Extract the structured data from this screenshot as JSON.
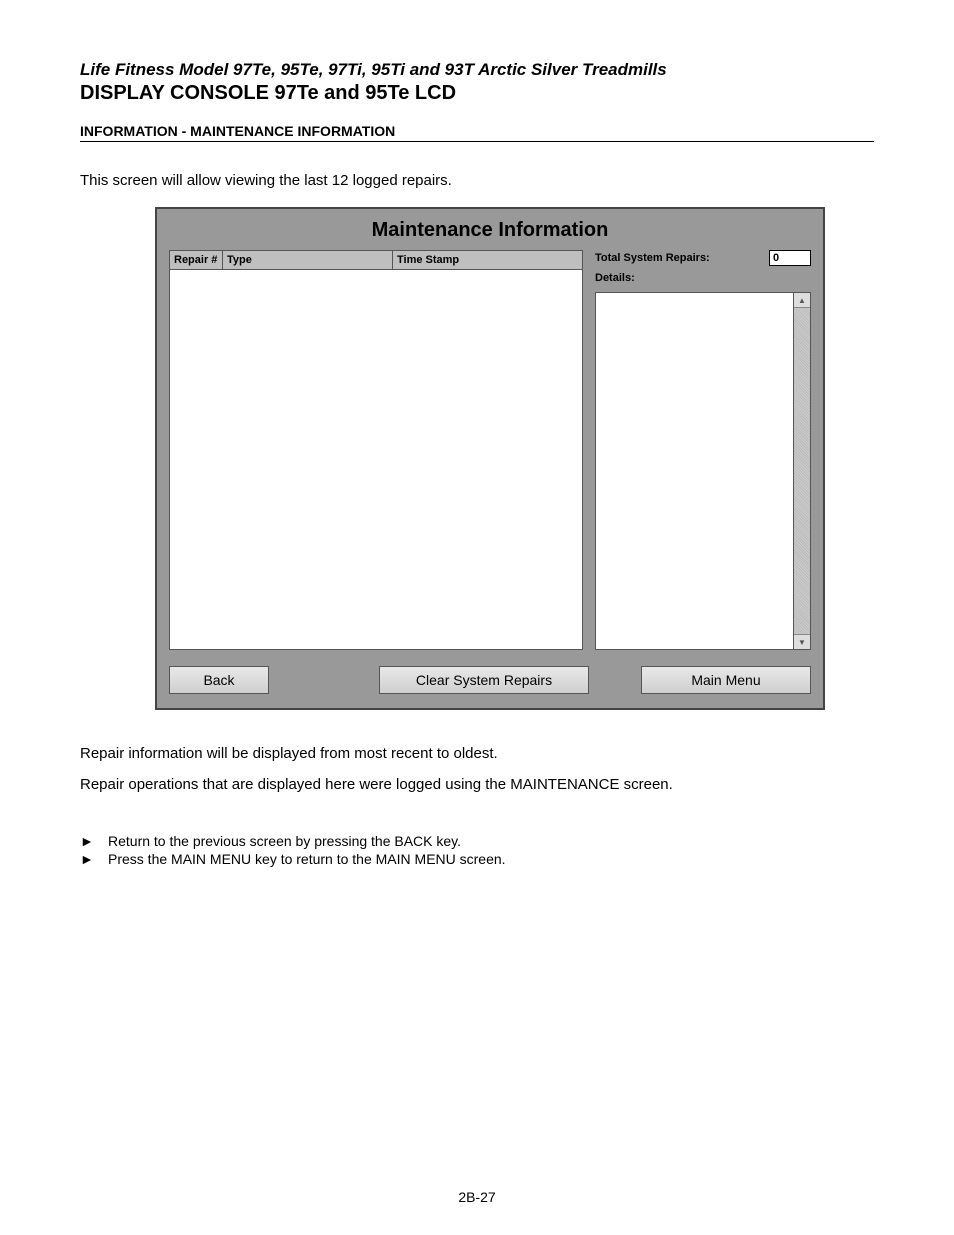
{
  "header": {
    "model_line": "Life Fitness Model 97Te, 95Te, 97Ti, 95Ti and 93T Arctic Silver Treadmills",
    "console_line": "DISPLAY CONSOLE 97Te and 95Te LCD",
    "section_heading": "INFORMATION - MAINTENANCE INFORMATION"
  },
  "intro": "This screen will allow viewing the last 12 logged repairs.",
  "panel": {
    "title": "Maintenance Information",
    "table_headers": {
      "repair": "Repair #",
      "type": "Type",
      "time": "Time Stamp"
    },
    "total_repairs_label": "Total System Repairs:",
    "total_repairs_value": "0",
    "details_label": "Details:",
    "buttons": {
      "back": "Back",
      "clear": "Clear System Repairs",
      "main": "Main Menu"
    }
  },
  "post_text": {
    "line1": "Repair information will be displayed from most recent to oldest.",
    "line2": "Repair operations that are displayed here were logged using the MAINTENANCE screen."
  },
  "bullets": {
    "arrow": "►",
    "b1": "Return to the previous screen by pressing the BACK key.",
    "b2": "Press the MAIN MENU key to return to the MAIN MENU screen."
  },
  "page_number": "2B-27"
}
